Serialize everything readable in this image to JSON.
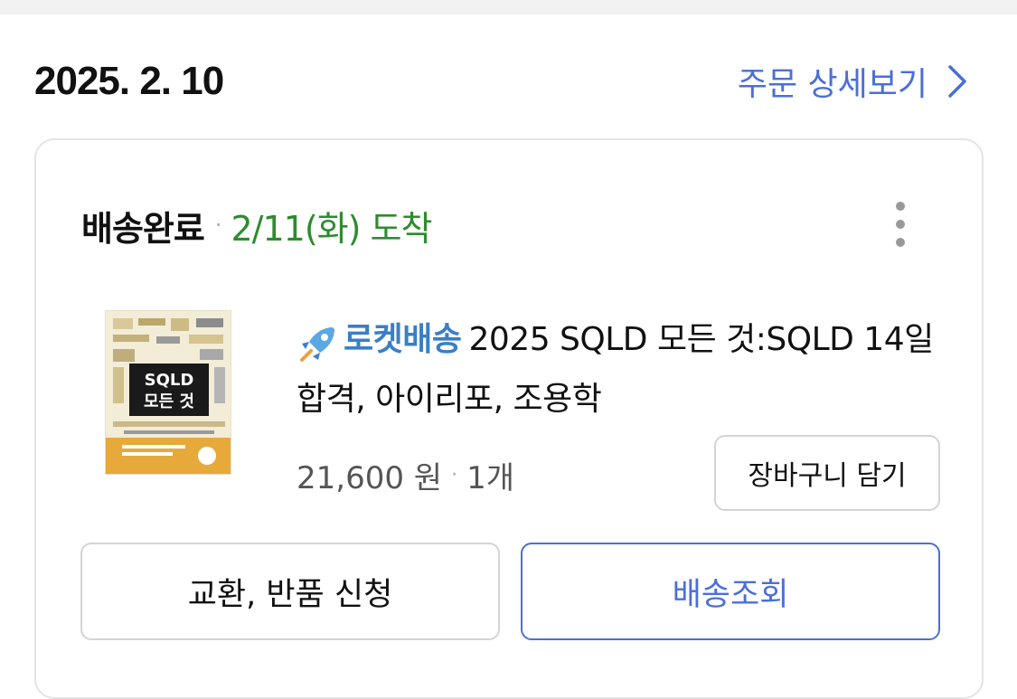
{
  "order": {
    "date": "2025. 2. 10",
    "detail_link_label": "주문 상세보기"
  },
  "shipment": {
    "status": "배송완료",
    "separator": "·",
    "arrival": "2/11(화) 도착"
  },
  "product": {
    "badge": "로켓배송",
    "title": "2025 SQLD 모든 것:SQLD 14일 합격, 아이리포, 조용학",
    "price": "21,600 원",
    "separator": "·",
    "quantity": "1개",
    "thumbnail": {
      "cover_title_line1": "SQLD",
      "cover_title_line2": "모든 것",
      "colors": {
        "cover_bg": "#f3ecd6",
        "title_block": "#1a1a1a",
        "band": "#e6a93a"
      }
    }
  },
  "buttons": {
    "add_to_cart": "장바구니 담기",
    "exchange_return": "교환, 반품 신청",
    "tracking": "배송조회"
  },
  "icons": {
    "more": "kebab-menu-icon",
    "detail": "chevron-right-icon",
    "rocket": "rocket-icon"
  },
  "colors": {
    "accent_blue": "#4a6fd8",
    "arrival_green": "#2e8b2e",
    "rocket_blue": "#3a7ec8"
  }
}
